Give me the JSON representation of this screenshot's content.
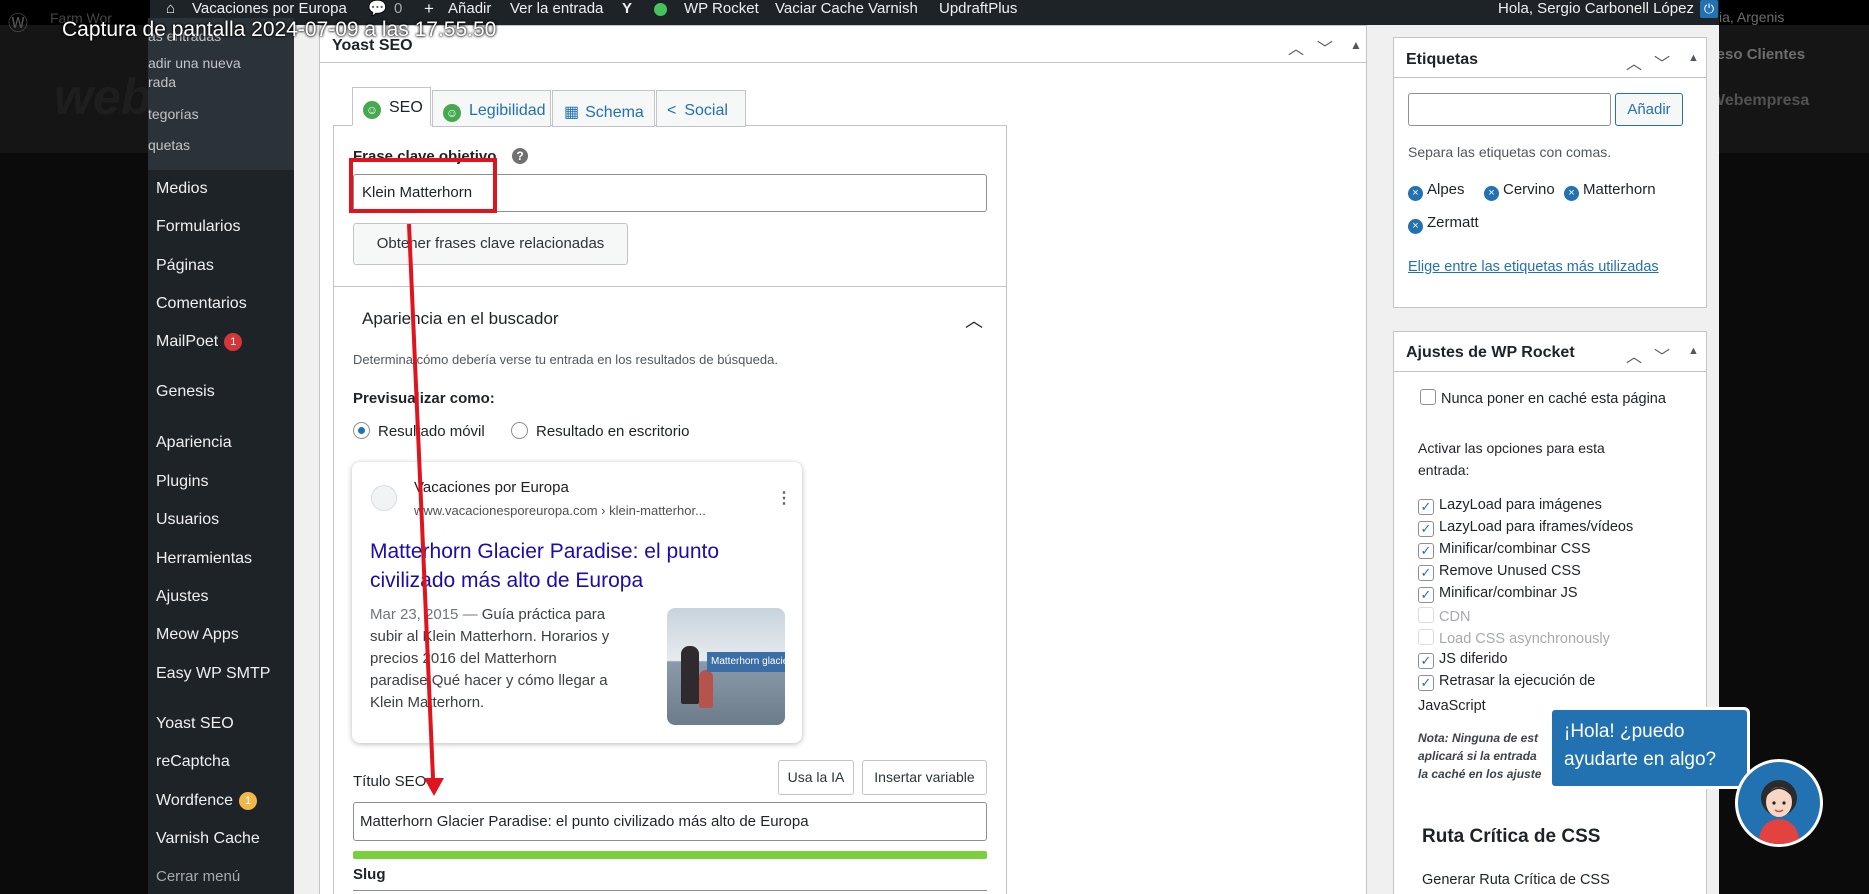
{
  "screenshot_label": "Captura de pantalla 2024-07-09 a las 17.55.50",
  "background": {
    "farm_text": "Farm Wor",
    "logo_text": "web",
    "right_top": "cia, Argenis",
    "right_1": "cceso Clientes",
    "right_2": "Webempresa"
  },
  "adminbar": {
    "site_name": "Vacaciones por Europa",
    "comments_count": "0",
    "add_new": "Añadir",
    "view_post": "Ver la entrada",
    "wp_rocket": "WP Rocket",
    "varnish": "Vaciar Cache Varnish",
    "updraft": "UpdraftPlus",
    "greeting": "Hola, Sergio Carbonell López"
  },
  "sidebar": {
    "submenu": [
      "Todas las entradas",
      "Añadir una nueva entrada",
      "Categorías",
      "Etiquetas"
    ],
    "submenu_visible": [
      "as entradas",
      "adir una nueva",
      "rada",
      "tegorías",
      "quetas"
    ],
    "items": [
      {
        "label": "Medios"
      },
      {
        "label": "Formularios"
      },
      {
        "label": "Páginas"
      },
      {
        "label": "Comentarios"
      },
      {
        "label": "MailPoet",
        "badge": "1"
      },
      {
        "label": "Genesis"
      },
      {
        "label": "Apariencia"
      },
      {
        "label": "Plugins"
      },
      {
        "label": "Usuarios"
      },
      {
        "label": "Herramientas"
      },
      {
        "label": "Ajustes"
      },
      {
        "label": "Meow Apps"
      },
      {
        "label": "Easy WP SMTP"
      },
      {
        "label": "Yoast SEO"
      },
      {
        "label": "reCaptcha"
      },
      {
        "label": "Wordfence",
        "badge": "1"
      },
      {
        "label": "Varnish Cache"
      },
      {
        "label": "Cerrar menú"
      }
    ]
  },
  "yoast": {
    "title": "Yoast SEO",
    "tabs": [
      "SEO",
      "Legibilidad",
      "Schema",
      "Social"
    ],
    "focus_label": "Frase clave objetivo",
    "focus_value": "Klein Matterhorn",
    "related_button": "Obtener frases clave relacionadas",
    "appearance_title": "Apariencia en el buscador",
    "appearance_desc": "Determina cómo debería verse tu entrada en los resultados de búsqueda.",
    "preview_label": "Previsualizar como:",
    "mobile_result": "Resultado móvil",
    "desktop_result": "Resultado en escritorio",
    "serp": {
      "site": "Vacaciones por Europa",
      "url": "www.vacacionesporeuropa.com › klein-matterhor...",
      "title": "Matterhorn Glacier Paradise: el punto civilizado más alto de Europa",
      "date": "Mar 23, 2015",
      "dash": "—",
      "desc": "Guía práctica para subir al Klein Matterhorn. Horarios y precios 2016 del Matterhorn paradise.Qué hacer y cómo llegar a Klein Matterhorn.",
      "thumb_text": "Matterhorn glacier"
    },
    "seo_title_label": "Título SEO",
    "ai_button": "Usa la IA",
    "insert_var_button": "Insertar variable",
    "seo_title_value": "Matterhorn Glacier Paradise: el punto civilizado más alto de Europa",
    "title_progress": 1.0,
    "slug_label": "Slug"
  },
  "tags_box": {
    "title": "Etiquetas",
    "add_button": "Añadir",
    "input_value": "",
    "hint": "Separa las etiquetas con comas.",
    "tags": [
      "Alpes",
      "Cervino",
      "Matterhorn",
      "Zermatt"
    ],
    "choose_link": "Elige entre las etiquetas más utilizadas"
  },
  "wprocket_box": {
    "title": "Ajustes de WP Rocket",
    "never_cache": "Nunca poner en caché esta página",
    "activate_text_1": "Activar las opciones para esta",
    "activate_text_2": "entrada:",
    "options": [
      {
        "label": "LazyLoad para imágenes",
        "checked": true,
        "disabled": false
      },
      {
        "label": "LazyLoad para iframes/vídeos",
        "checked": true,
        "disabled": false
      },
      {
        "label": "Minificar/combinar CSS",
        "checked": true,
        "disabled": false
      },
      {
        "label": "Remove Unused CSS",
        "checked": true,
        "disabled": false
      },
      {
        "label": "Minificar/combinar JS",
        "checked": true,
        "disabled": false
      },
      {
        "label": "CDN",
        "checked": false,
        "disabled": true
      },
      {
        "label": "Load CSS asynchronously",
        "checked": false,
        "disabled": true
      },
      {
        "label": "JS diferido",
        "checked": true,
        "disabled": false
      },
      {
        "label": "Retrasar la ejecución de",
        "checked": true,
        "disabled": false
      }
    ],
    "option_last_line": "JavaScript",
    "note_1": "Nota: Ninguna de est",
    "note_2": "aplicará si la entrada",
    "note_3": "la caché en los ajuste",
    "css_title": "Ruta Crítica de CSS",
    "css_sub": "Generar Ruta Crítica de CSS"
  },
  "chat": {
    "line1": "¡Hola! ¿puedo",
    "line2": "ayudarte en algo?"
  },
  "colors": {
    "accent": "#2271b1",
    "annotation": "#e0141e",
    "admin_bar": "#1d2327",
    "good": "#46a84f"
  }
}
